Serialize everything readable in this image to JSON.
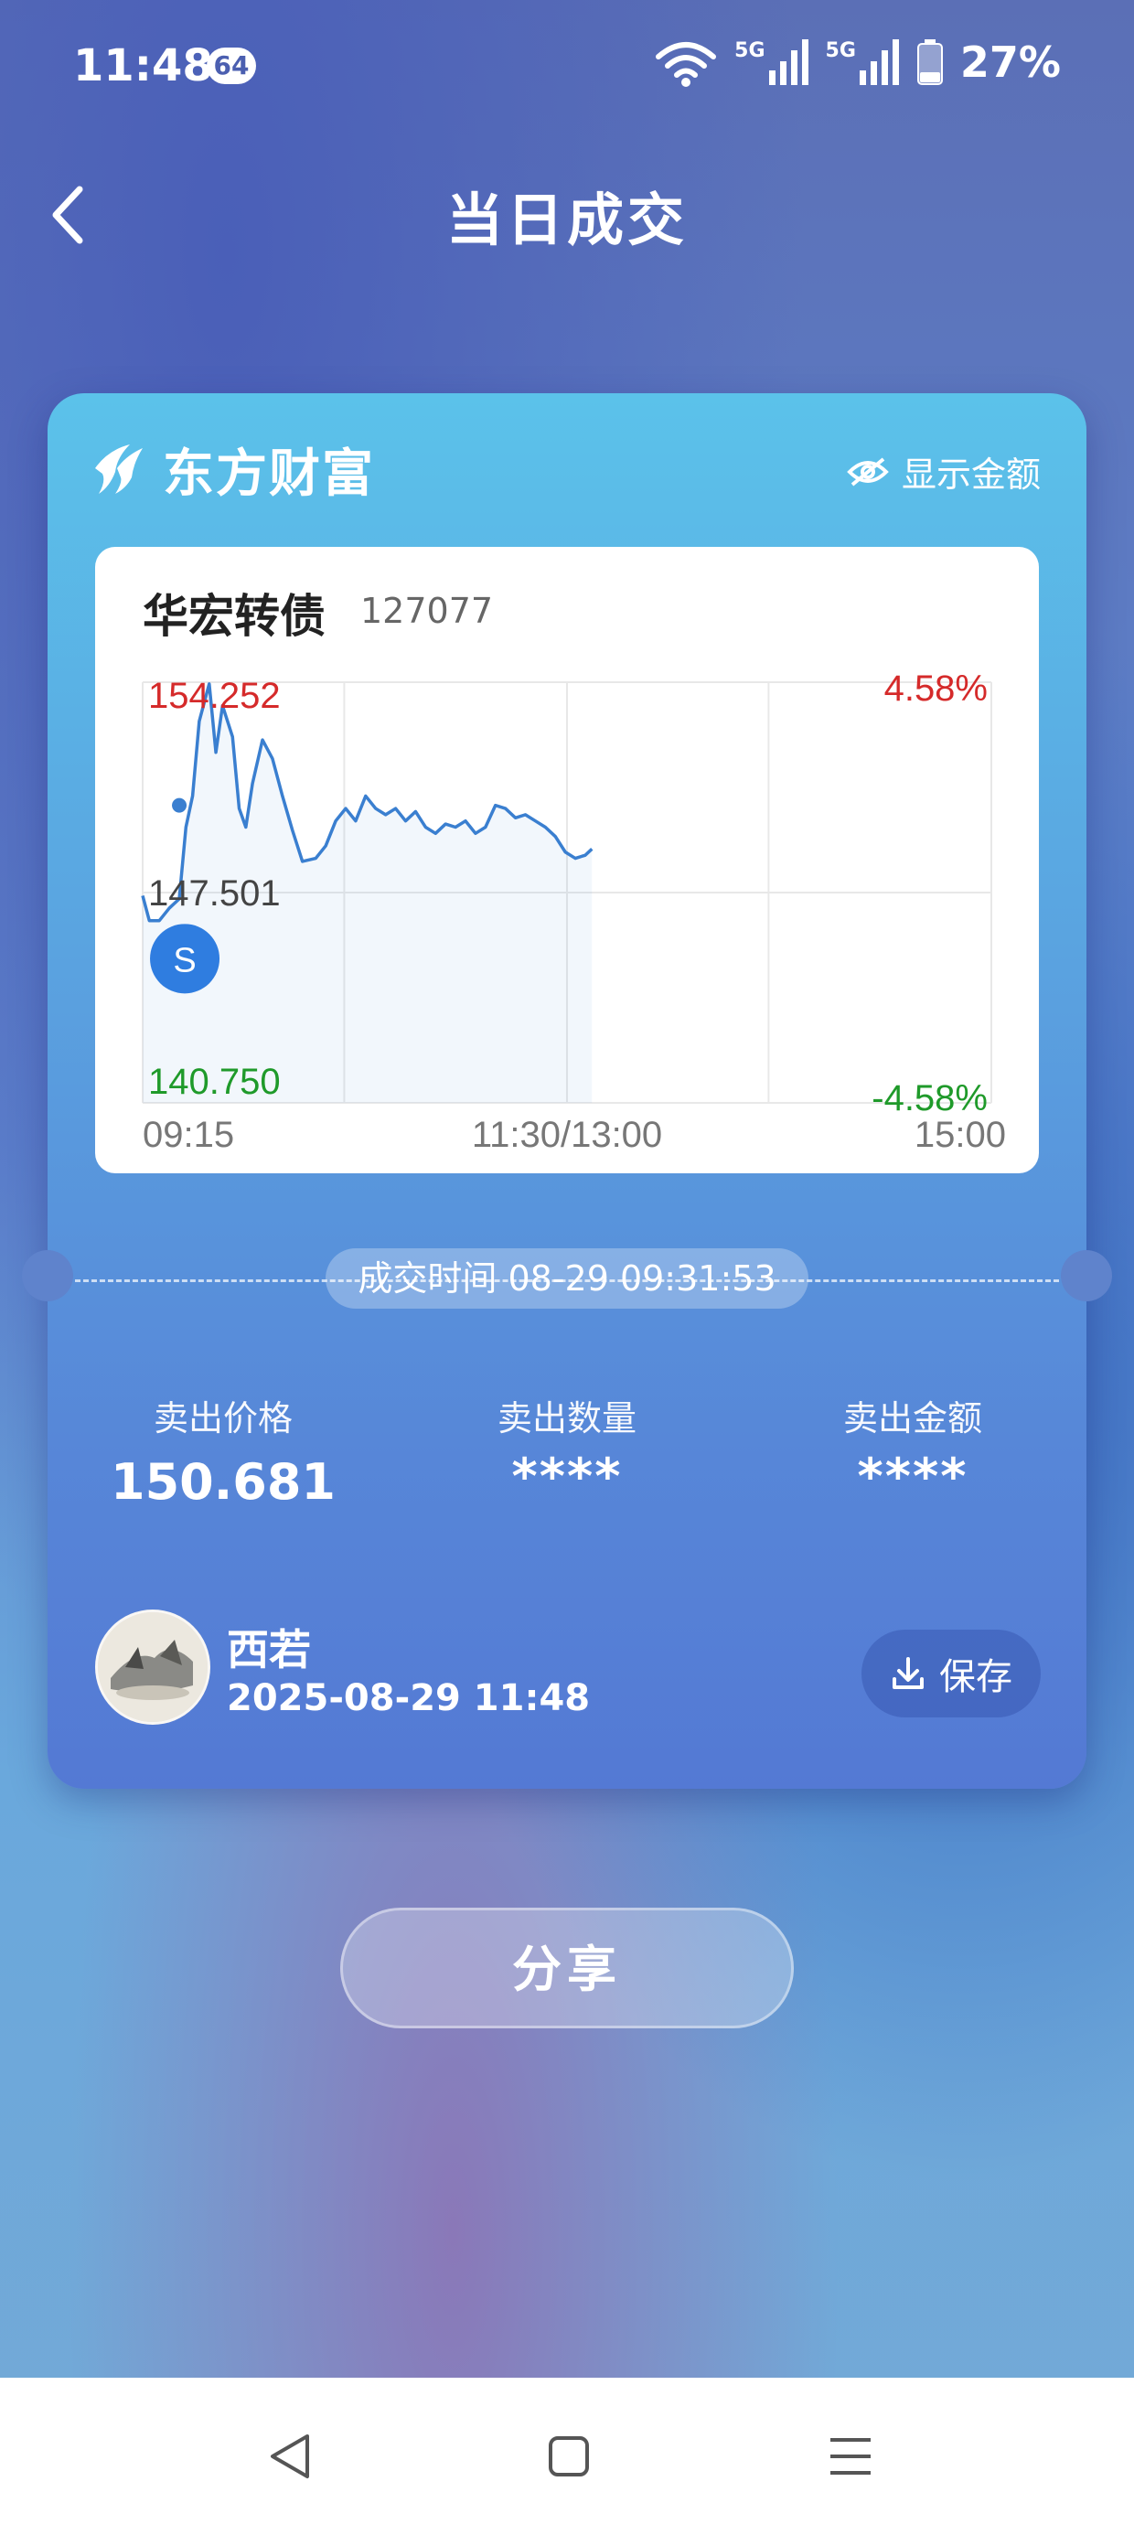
{
  "status_bar": {
    "time": "11:48",
    "badge": "64",
    "signal_1": "5G",
    "signal_2": "5G",
    "battery": "27%"
  },
  "header": {
    "title": "当日成交",
    "back_icon": "chevron-left-icon"
  },
  "card": {
    "brand_name": "东方财富",
    "show_amount_label": "显示金额",
    "stock_name": "华宏转债",
    "stock_code": "127077",
    "trade_time_label": "成交时间 08-29 09:31:53",
    "metrics": [
      {
        "label": "卖出价格",
        "value": "150.681"
      },
      {
        "label": "卖出数量",
        "value": "****"
      },
      {
        "label": "卖出金额",
        "value": "****"
      }
    ],
    "user": {
      "name": "西若",
      "datetime": "2025-08-29 11:48"
    },
    "save_label": "保存"
  },
  "share_label": "分享",
  "colors": {
    "up": "#d52a2a",
    "down": "#1f9a2a",
    "line": "#3a7fd0",
    "marker": "#2f7de0"
  },
  "chart_data": {
    "type": "line",
    "y_top_label": "154.252",
    "y_mid_label": "147.501",
    "y_bottom_label": "140.750",
    "pct_top_label": "4.58%",
    "pct_bottom_label": "-4.58%",
    "x_tick_labels": [
      "09:15",
      "11:30/13:00",
      "15:00"
    ],
    "marker_label": "S",
    "ylim": [
      140.75,
      154.252
    ],
    "series": [
      {
        "values": [
          [
            0,
            147.4
          ],
          [
            2,
            146.6
          ],
          [
            5,
            146.6
          ],
          [
            8,
            147.0
          ],
          [
            11,
            147.3
          ],
          [
            13,
            149.6
          ],
          [
            15,
            150.6
          ],
          [
            17,
            153.0
          ],
          [
            20,
            154.2
          ],
          [
            22,
            152.0
          ],
          [
            24,
            153.5
          ],
          [
            27,
            152.5
          ],
          [
            29,
            150.2
          ],
          [
            31,
            149.6
          ],
          [
            33,
            151.0
          ],
          [
            36,
            152.4
          ],
          [
            39,
            151.8
          ],
          [
            42,
            150.6
          ],
          [
            45,
            149.5
          ],
          [
            48,
            148.5
          ],
          [
            52,
            148.6
          ],
          [
            55,
            149.0
          ],
          [
            58,
            149.8
          ],
          [
            61,
            150.2
          ],
          [
            64,
            149.8
          ],
          [
            67,
            150.6
          ],
          [
            70,
            150.2
          ],
          [
            73,
            150.0
          ],
          [
            76,
            150.2
          ],
          [
            79,
            149.8
          ],
          [
            82,
            150.1
          ],
          [
            85,
            149.6
          ],
          [
            88,
            149.4
          ],
          [
            91,
            149.7
          ],
          [
            94,
            149.6
          ],
          [
            97,
            149.8
          ],
          [
            100,
            149.4
          ],
          [
            103,
            149.6
          ],
          [
            106,
            150.3
          ],
          [
            109,
            150.2
          ],
          [
            112,
            149.9
          ],
          [
            115,
            150.0
          ],
          [
            118,
            149.8
          ],
          [
            121,
            149.6
          ],
          [
            124,
            149.3
          ],
          [
            127,
            148.8
          ],
          [
            130,
            148.6
          ],
          [
            133,
            148.7
          ],
          [
            135,
            148.9
          ]
        ]
      }
    ],
    "marker_x": 11,
    "marker_y": 146.2,
    "x_total": 255,
    "grid": true
  }
}
